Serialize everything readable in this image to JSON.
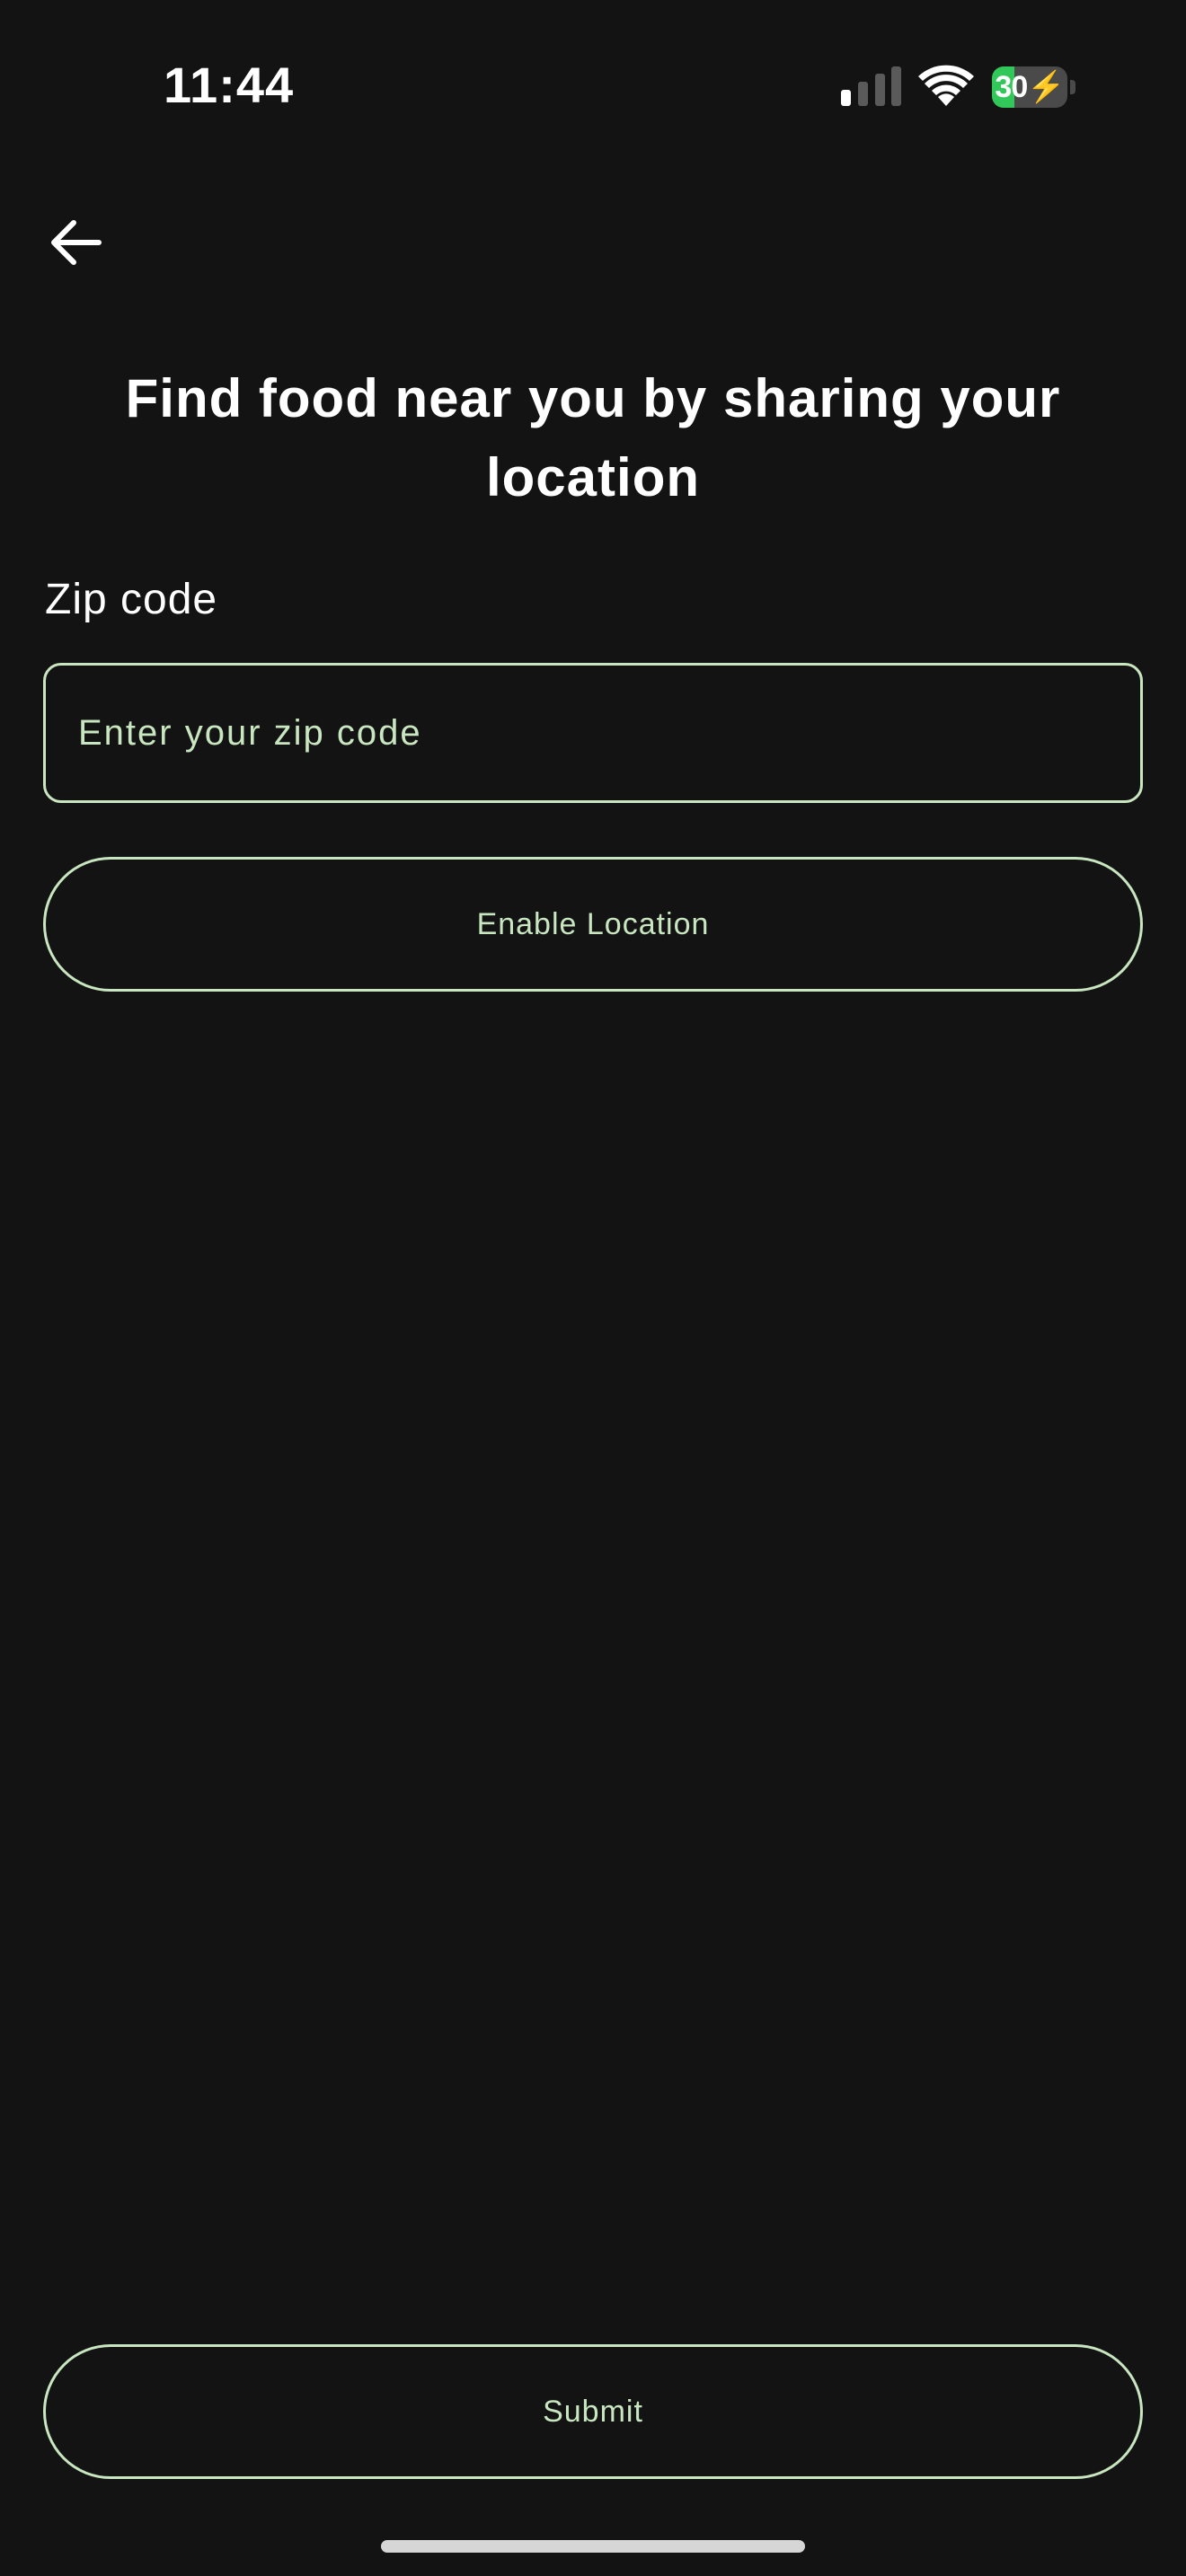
{
  "status_bar": {
    "time": "11:44",
    "battery_text": "30",
    "battery_level": 0.3,
    "signal_icon": "cellular-signal-icon",
    "wifi_icon": "wifi-icon",
    "battery_icon": "battery-charging-icon"
  },
  "nav": {
    "back_icon": "arrow-left-icon"
  },
  "main": {
    "title": "Find food near you by sharing your location",
    "zip_label": "Zip code",
    "zip_value": "",
    "zip_placeholder": "Enter your zip code",
    "enable_location_label": "Enable Location",
    "submit_label": "Submit"
  },
  "colors": {
    "background": "#131313",
    "accent": "#c8e6c0",
    "battery_fill": "#32c759",
    "text": "#ffffff"
  }
}
